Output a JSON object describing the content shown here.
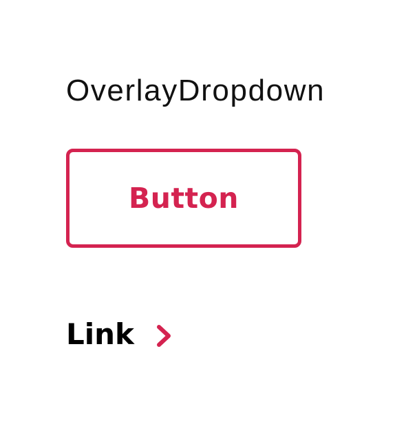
{
  "component": {
    "title": "OverlayDropdown"
  },
  "button": {
    "label": "Button"
  },
  "link": {
    "label": "Link",
    "icon": "chevron-right-icon"
  },
  "colors": {
    "accent": "#d42350",
    "text": "#111111",
    "background": "#ffffff"
  }
}
